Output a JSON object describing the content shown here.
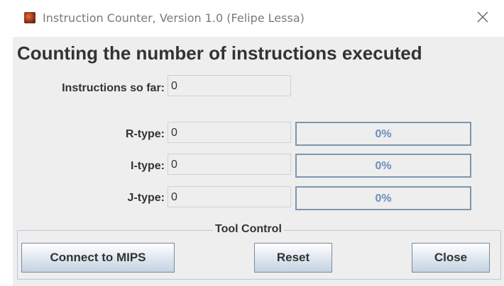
{
  "window": {
    "title": "Instruction Counter, Version 1.0 (Felipe Lessa)",
    "close_icon": "close-x-icon"
  },
  "heading": "Counting the number of instructions executed",
  "total": {
    "label": "Instructions so far:",
    "value": "0"
  },
  "types": [
    {
      "label": "R-type:",
      "value": "0",
      "percent_text": "0%",
      "fraction": 0
    },
    {
      "label": "I-type:",
      "value": "0",
      "percent_text": "0%",
      "fraction": 0
    },
    {
      "label": "J-type:",
      "value": "0",
      "percent_text": "0%",
      "fraction": 0
    }
  ],
  "tool_control": {
    "title": "Tool Control",
    "buttons": {
      "connect": "Connect to MIPS",
      "reset": "Reset",
      "close": "Close"
    }
  },
  "colors": {
    "bar_border": "#7e96ad",
    "bar_text": "#6c8ebf",
    "panel_bg": "#eeeeee"
  }
}
